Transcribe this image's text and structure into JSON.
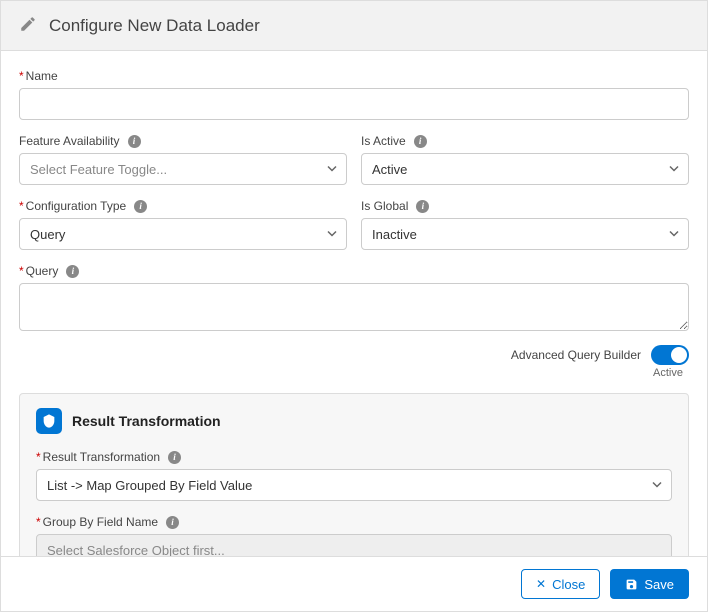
{
  "header": {
    "title": "Configure New Data Loader"
  },
  "fields": {
    "name": {
      "label": "Name",
      "value": ""
    },
    "feature_availability": {
      "label": "Feature Availability",
      "placeholder": "Select Feature Toggle..."
    },
    "is_active": {
      "label": "Is Active",
      "value": "Active"
    },
    "configuration_type": {
      "label": "Configuration Type",
      "value": "Query"
    },
    "is_global": {
      "label": "Is Global",
      "value": "Inactive"
    },
    "query": {
      "label": "Query",
      "value": ""
    }
  },
  "advanced_query_builder": {
    "label": "Advanced Query Builder",
    "state": "Active",
    "enabled": true
  },
  "result_transformation": {
    "section_title": "Result Transformation",
    "transformation": {
      "label": "Result Transformation",
      "value": "List -> Map Grouped By Field Value"
    },
    "group_by": {
      "label": "Group By Field Name",
      "placeholder": "Select Salesforce Object first..."
    }
  },
  "footer": {
    "close": "Close",
    "save": "Save"
  }
}
